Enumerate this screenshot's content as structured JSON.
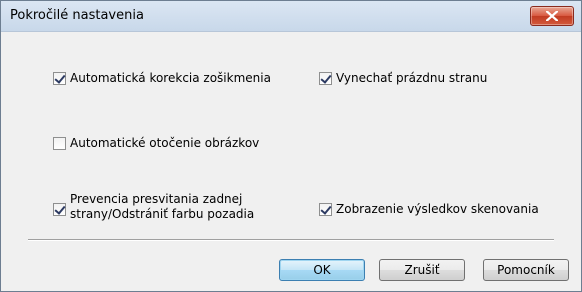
{
  "dialog": {
    "title": "Pokročilé nastavenia",
    "close_icon": "close-x-icon"
  },
  "options": {
    "auto_deskew": {
      "label": "Automatická korekcia zošikmenia",
      "checked": true
    },
    "skip_blank_page": {
      "label": "Vynechať prázdnu stranu",
      "checked": true
    },
    "auto_rotate": {
      "label": "Automatické otočenie obrázkov",
      "checked": false
    },
    "bleed_through": {
      "label_line1": "Prevencia presvitania zadnej",
      "label_line2": "strany/Odstrániť farbu pozadia",
      "checked": true
    },
    "show_results": {
      "label": "Zobrazenie výsledkov skenovania",
      "checked": true
    }
  },
  "buttons": {
    "ok": "OK",
    "cancel": "Zrušiť",
    "help": "Pomocník"
  },
  "colors": {
    "close_button": "#c94a30",
    "default_button_border": "#3c7fb1"
  }
}
